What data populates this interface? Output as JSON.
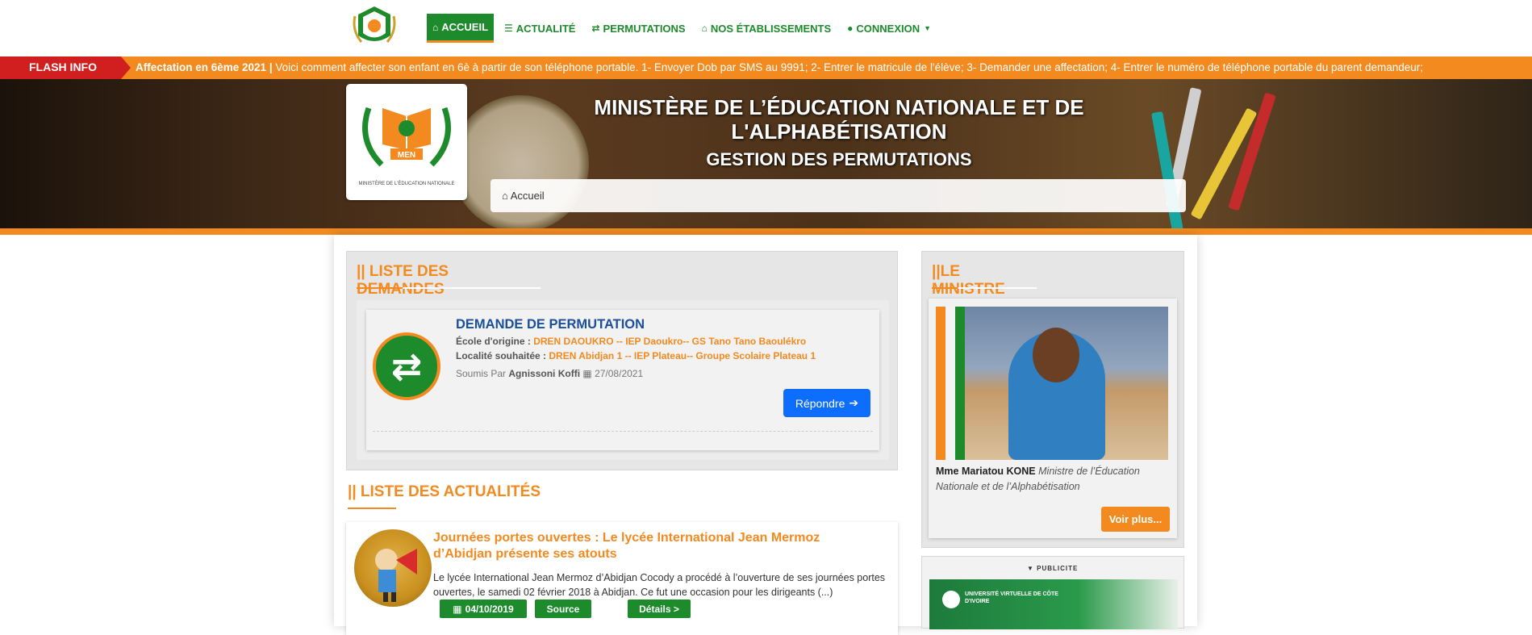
{
  "nav": {
    "items": [
      {
        "label": "ACCUEIL",
        "icon": "home-icon"
      },
      {
        "label": "ACTUALITÉ",
        "icon": "list-icon"
      },
      {
        "label": "PERMUTATIONS",
        "icon": "exchange-icon"
      },
      {
        "label": "NOS ÉTABLISSEMENTS",
        "icon": "institution-icon"
      },
      {
        "label": "CONNEXION",
        "icon": "user-icon"
      }
    ]
  },
  "flash": {
    "label": "FLASH INFO",
    "bold": "Affectation en 6ème 2021 |",
    "text": " Voici comment affecter son enfant en 6è à partir de son téléphone portable. 1- Envoyer Dob par SMS au 9991; 2- Entrer le matricule de l'élève; 3- Demander une affectation; 4- Entrer le numéro de téléphone portable du parent demandeur;"
  },
  "header": {
    "title": "MINISTÈRE DE L’ÉDUCATION NATIONALE ET DE L'ALPHABÉTISATION",
    "subtitle": "GESTION DES PERMUTATIONS",
    "breadcrumb": "Accueil",
    "logo_text": "MEN",
    "logo_caption": "MINISTÈRE DE L'ÉDUCATION NATIONALE"
  },
  "demandes": {
    "section_title": "|| LISTE DES DEMANDES",
    "title": "DEMANDE DE PERMUTATION",
    "origin_label": "École d'origine :",
    "origin_value": "DREN DAOUKRO -- IEP Daoukro-- GS Tano Tano Baoulékro",
    "wish_label": "Localité souhaitée :",
    "wish_value": "DREN Abidjan 1 -- IEP Plateau-- Groupe Scolaire Plateau 1",
    "submitted_prefix": "Soumis Par",
    "submitted_by": "Agnissoni Koffi",
    "date": "27/08/2021",
    "reply_button": "Répondre"
  },
  "actualites": {
    "section_title": "|| LISTE DES ACTUALITÉS",
    "title": "Journées portes ouvertes : Le lycée International Jean Mermoz d’Abidjan présente ses atouts",
    "text": "Le lycée International Jean Mermoz d’Abidjan Cocody a procédé à l’ouverture de ses journées portes ouvertes, le samedi 02 février 2018 à Abidjan. Ce fut une occasion pour les dirigeants (...)",
    "date": "04/10/2019",
    "source_button": "Source",
    "details_button": "Détails >"
  },
  "ministre": {
    "section_title": "||LE MINISTRE",
    "name": "Mme Mariatou KONE",
    "role": "Ministre de l’Éducation Nationale et de l’Alphabétisation",
    "more_button": "Voir plus..."
  },
  "publicite": {
    "label": "PUBLICITE",
    "banner_text": "UNIVERSITÉ VIRTUELLE DE CÔTE D'IVOIRE"
  },
  "colors": {
    "green": "#1d8a2c",
    "orange": "#f28a1f",
    "red": "#d11f1f",
    "blue": "#1a4f9b"
  }
}
